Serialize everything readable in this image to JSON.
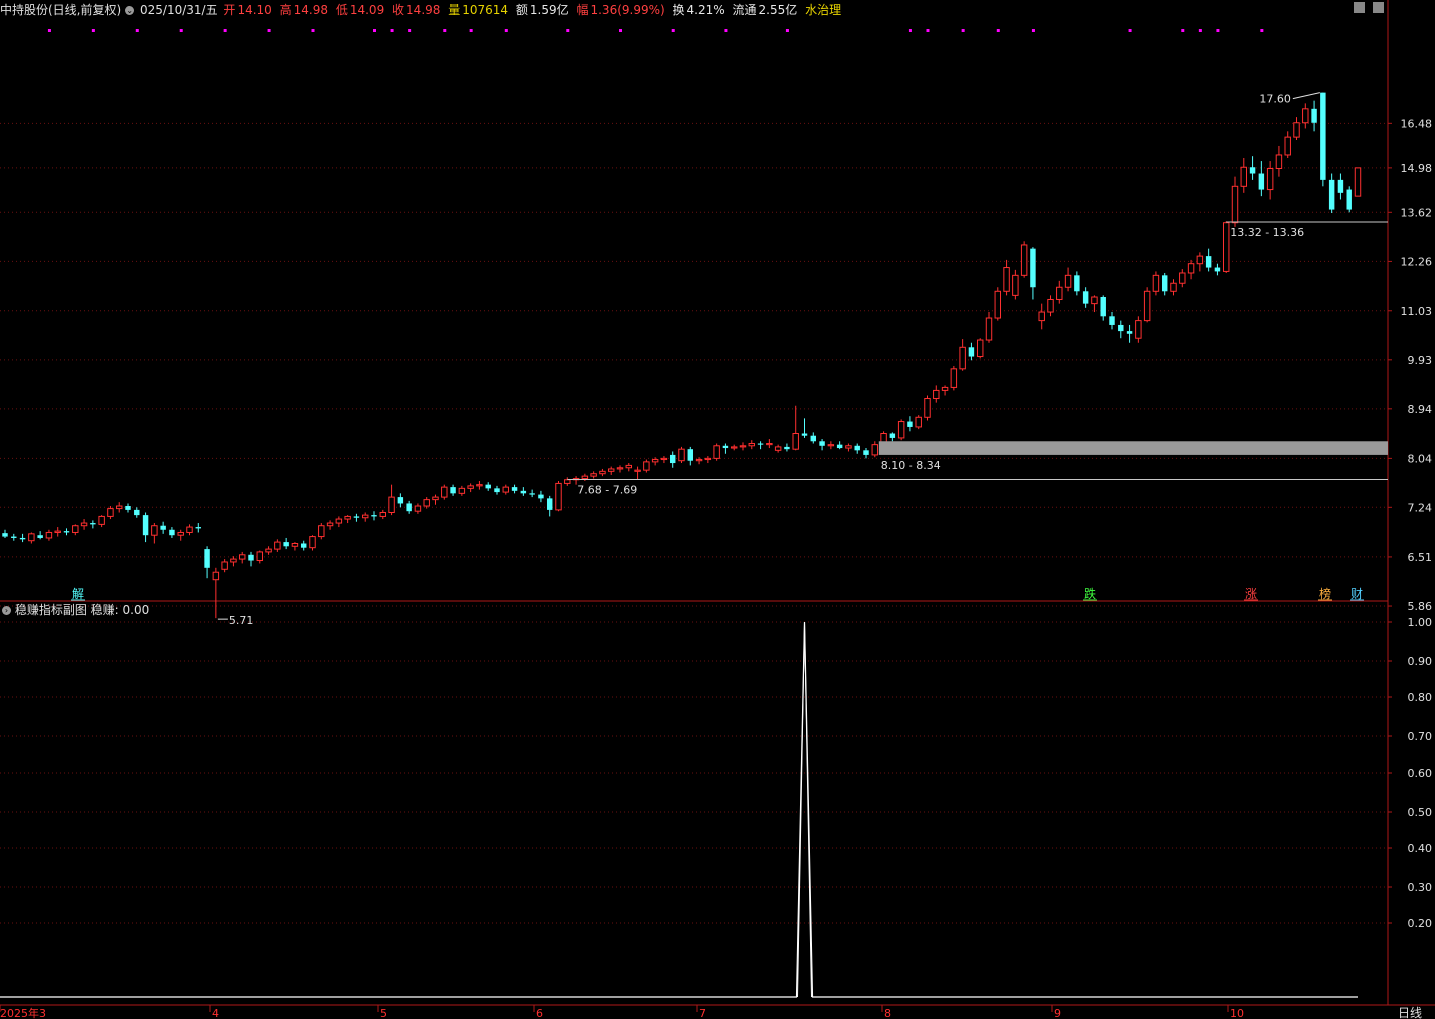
{
  "header": {
    "title": "中持股份(日线,前复权)",
    "date": "025/10/31/五",
    "open_label": "开",
    "open": "14.10",
    "high_label": "高",
    "high": "14.98",
    "low_label": "低",
    "low": "14.09",
    "close_label": "收",
    "close": "14.98",
    "volume_label": "量",
    "volume": "107614",
    "amount_label": "额",
    "amount": "1.59亿",
    "change_label": "幅",
    "change": "1.36(9.99%)",
    "turnover_label": "换",
    "turnover": "4.21%",
    "float_label": "流通",
    "float": "2.55亿",
    "sector": "水治理"
  },
  "subchart": {
    "title": "稳赚指标副图",
    "value_label": "稳赚: 0.00"
  },
  "timeframe_label": "日线",
  "colors": {
    "up": "#ff3030",
    "down": "#54ffff",
    "grid": "#6a1010",
    "axis": "#b01818",
    "text": "#e0e0e0",
    "magenta": "#ff00ff"
  },
  "chart_data": [
    {
      "type": "candlestick",
      "y_ticks": [
        "16.48",
        "14.98",
        "13.62",
        "12.26",
        "11.03",
        "9.93",
        "8.94",
        "8.04",
        "7.24",
        "6.51",
        "5.86"
      ],
      "x_ticks": [
        "2025年3",
        "4",
        "5",
        "6",
        "7",
        "8",
        "9",
        "10"
      ],
      "annotations": [
        {
          "text": "17.60",
          "role": "high"
        },
        {
          "text": "5.71",
          "role": "low"
        },
        {
          "text": "7.68 - 7.69",
          "role": "range"
        },
        {
          "text": "8.10 - 8.34",
          "role": "range"
        },
        {
          "text": "13.32 - 13.36",
          "role": "range"
        }
      ],
      "event_markers": [
        {
          "text": "解",
          "color": "#54ffff"
        },
        {
          "text": "跌",
          "color": "#40ff40"
        },
        {
          "text": "涨",
          "color": "#ff4040"
        },
        {
          "text": "榜",
          "color": "#ffb040"
        },
        {
          "text": "财",
          "color": "#54d0ff"
        }
      ],
      "candles": [
        [
          6.85,
          6.9,
          6.78,
          6.8
        ],
        [
          6.8,
          6.84,
          6.74,
          6.78
        ],
        [
          6.78,
          6.84,
          6.72,
          6.76
        ],
        [
          6.74,
          6.86,
          6.7,
          6.84
        ],
        [
          6.82,
          6.88,
          6.76,
          6.78
        ],
        [
          6.78,
          6.9,
          6.74,
          6.86
        ],
        [
          6.86,
          6.94,
          6.8,
          6.88
        ],
        [
          6.88,
          6.92,
          6.82,
          6.86
        ],
        [
          6.86,
          6.98,
          6.82,
          6.96
        ],
        [
          6.96,
          7.06,
          6.9,
          7.0
        ],
        [
          7.0,
          7.04,
          6.92,
          6.98
        ],
        [
          6.98,
          7.12,
          6.94,
          7.1
        ],
        [
          7.1,
          7.26,
          7.06,
          7.22
        ],
        [
          7.22,
          7.32,
          7.16,
          7.26
        ],
        [
          7.26,
          7.3,
          7.16,
          7.2
        ],
        [
          7.2,
          7.24,
          7.08,
          7.12
        ],
        [
          7.12,
          7.16,
          6.72,
          6.82
        ],
        [
          6.82,
          7.0,
          6.7,
          6.96
        ],
        [
          6.96,
          7.02,
          6.84,
          6.9
        ],
        [
          6.9,
          6.94,
          6.78,
          6.82
        ],
        [
          6.82,
          6.9,
          6.74,
          6.86
        ],
        [
          6.86,
          6.98,
          6.82,
          6.94
        ],
        [
          6.94,
          7.0,
          6.86,
          6.92
        ],
        [
          6.62,
          6.66,
          6.22,
          6.36
        ],
        [
          6.2,
          6.36,
          5.71,
          6.3
        ],
        [
          6.34,
          6.48,
          6.3,
          6.44
        ],
        [
          6.44,
          6.52,
          6.38,
          6.48
        ],
        [
          6.48,
          6.58,
          6.42,
          6.54
        ],
        [
          6.54,
          6.58,
          6.38,
          6.46
        ],
        [
          6.46,
          6.6,
          6.42,
          6.58
        ],
        [
          6.58,
          6.66,
          6.54,
          6.62
        ],
        [
          6.62,
          6.76,
          6.58,
          6.72
        ],
        [
          6.72,
          6.78,
          6.62,
          6.66
        ],
        [
          6.66,
          6.72,
          6.6,
          6.7
        ],
        [
          6.7,
          6.74,
          6.6,
          6.64
        ],
        [
          6.64,
          6.82,
          6.6,
          6.8
        ],
        [
          6.8,
          7.0,
          6.76,
          6.96
        ],
        [
          6.96,
          7.04,
          6.9,
          7.0
        ],
        [
          7.0,
          7.1,
          6.94,
          7.06
        ],
        [
          7.06,
          7.12,
          7.0,
          7.1
        ],
        [
          7.1,
          7.14,
          7.02,
          7.08
        ],
        [
          7.08,
          7.16,
          7.02,
          7.12
        ],
        [
          7.12,
          7.18,
          7.04,
          7.1
        ],
        [
          7.1,
          7.2,
          7.06,
          7.16
        ],
        [
          7.16,
          7.6,
          7.12,
          7.4
        ],
        [
          7.4,
          7.46,
          7.24,
          7.3
        ],
        [
          7.3,
          7.34,
          7.14,
          7.18
        ],
        [
          7.18,
          7.3,
          7.14,
          7.26
        ],
        [
          7.26,
          7.4,
          7.22,
          7.36
        ],
        [
          7.36,
          7.44,
          7.28,
          7.4
        ],
        [
          7.4,
          7.6,
          7.36,
          7.56
        ],
        [
          7.56,
          7.6,
          7.42,
          7.46
        ],
        [
          7.46,
          7.58,
          7.42,
          7.54
        ],
        [
          7.54,
          7.62,
          7.48,
          7.58
        ],
        [
          7.58,
          7.66,
          7.52,
          7.6
        ],
        [
          7.6,
          7.64,
          7.5,
          7.54
        ],
        [
          7.54,
          7.58,
          7.44,
          7.48
        ],
        [
          7.48,
          7.6,
          7.44,
          7.56
        ],
        [
          7.56,
          7.6,
          7.46,
          7.5
        ],
        [
          7.5,
          7.56,
          7.42,
          7.46
        ],
        [
          7.46,
          7.52,
          7.4,
          7.44
        ],
        [
          7.44,
          7.5,
          7.32,
          7.38
        ],
        [
          7.38,
          7.42,
          7.1,
          7.2
        ],
        [
          7.2,
          7.66,
          7.18,
          7.62
        ],
        [
          7.62,
          7.72,
          7.58,
          7.68
        ],
        [
          7.68,
          7.74,
          7.6,
          7.7
        ],
        [
          7.7,
          7.78,
          7.66,
          7.74
        ],
        [
          7.74,
          7.82,
          7.7,
          7.78
        ],
        [
          7.78,
          7.86,
          7.74,
          7.82
        ],
        [
          7.82,
          7.9,
          7.76,
          7.86
        ],
        [
          7.86,
          7.92,
          7.8,
          7.88
        ],
        [
          7.88,
          7.96,
          7.82,
          7.92
        ],
        [
          7.82,
          7.9,
          7.68,
          7.84
        ],
        [
          7.84,
          8.02,
          7.8,
          7.98
        ],
        [
          7.98,
          8.06,
          7.92,
          8.02
        ],
        [
          8.02,
          8.08,
          7.96,
          8.04
        ],
        [
          8.1,
          8.16,
          7.88,
          7.96
        ],
        [
          8.0,
          8.24,
          7.96,
          8.2
        ],
        [
          8.2,
          8.24,
          7.92,
          8.0
        ],
        [
          8.0,
          8.06,
          7.94,
          8.02
        ],
        [
          8.02,
          8.08,
          7.96,
          8.04
        ],
        [
          8.04,
          8.3,
          8.0,
          8.26
        ],
        [
          8.26,
          8.3,
          8.12,
          8.22
        ],
        [
          8.22,
          8.28,
          8.18,
          8.24
        ],
        [
          8.24,
          8.32,
          8.18,
          8.26
        ],
        [
          8.26,
          8.36,
          8.2,
          8.3
        ],
        [
          8.3,
          8.34,
          8.2,
          8.28
        ],
        [
          8.28,
          8.38,
          8.22,
          8.3
        ],
        [
          8.18,
          8.28,
          8.14,
          8.24
        ],
        [
          8.24,
          8.3,
          8.16,
          8.2
        ],
        [
          8.2,
          9.0,
          8.18,
          8.48
        ],
        [
          8.48,
          8.76,
          8.4,
          8.44
        ],
        [
          8.44,
          8.5,
          8.3,
          8.34
        ],
        [
          8.34,
          8.38,
          8.18,
          8.26
        ],
        [
          8.26,
          8.34,
          8.2,
          8.28
        ],
        [
          8.28,
          8.34,
          8.2,
          8.22
        ],
        [
          8.22,
          8.3,
          8.16,
          8.26
        ],
        [
          8.26,
          8.3,
          8.12,
          8.18
        ],
        [
          8.18,
          8.22,
          8.04,
          8.1
        ],
        [
          8.1,
          8.34,
          8.06,
          8.28
        ],
        [
          8.28,
          8.52,
          8.26,
          8.48
        ],
        [
          8.48,
          8.5,
          8.34,
          8.4
        ],
        [
          8.4,
          8.74,
          8.36,
          8.7
        ],
        [
          8.7,
          8.8,
          8.52,
          8.6
        ],
        [
          8.6,
          8.82,
          8.56,
          8.78
        ],
        [
          8.78,
          9.2,
          8.72,
          9.14
        ],
        [
          9.14,
          9.4,
          9.06,
          9.3
        ],
        [
          9.3,
          9.4,
          9.2,
          9.36
        ],
        [
          9.36,
          9.8,
          9.3,
          9.74
        ],
        [
          9.74,
          10.38,
          9.7,
          10.2
        ],
        [
          10.2,
          10.3,
          9.92,
          10.0
        ],
        [
          10.0,
          10.4,
          9.96,
          10.36
        ],
        [
          10.36,
          11.0,
          10.3,
          10.86
        ],
        [
          10.86,
          11.6,
          10.8,
          11.5
        ],
        [
          11.5,
          12.3,
          11.4,
          12.1
        ],
        [
          11.4,
          12.04,
          11.3,
          11.9
        ],
        [
          11.9,
          12.8,
          11.84,
          12.7
        ],
        [
          12.6,
          12.64,
          11.3,
          11.6
        ],
        [
          10.8,
          11.2,
          10.6,
          11.0
        ],
        [
          11.0,
          11.4,
          10.9,
          11.3
        ],
        [
          11.3,
          11.76,
          11.2,
          11.6
        ],
        [
          11.6,
          12.1,
          11.5,
          11.9
        ],
        [
          11.9,
          12.0,
          11.4,
          11.5
        ],
        [
          11.5,
          11.6,
          11.1,
          11.2
        ],
        [
          11.2,
          11.4,
          11.0,
          11.36
        ],
        [
          11.36,
          11.4,
          10.8,
          10.9
        ],
        [
          10.9,
          11.0,
          10.6,
          10.7
        ],
        [
          10.7,
          10.8,
          10.4,
          10.56
        ],
        [
          10.56,
          10.7,
          10.3,
          10.5
        ],
        [
          10.4,
          10.9,
          10.3,
          10.8
        ],
        [
          10.8,
          11.6,
          10.76,
          11.5
        ],
        [
          11.5,
          12.0,
          11.4,
          11.9
        ],
        [
          11.9,
          11.96,
          11.4,
          11.5
        ],
        [
          11.5,
          11.8,
          11.4,
          11.7
        ],
        [
          11.7,
          12.06,
          11.6,
          11.96
        ],
        [
          11.96,
          12.3,
          11.8,
          12.2
        ],
        [
          12.2,
          12.5,
          12.0,
          12.4
        ],
        [
          12.4,
          12.6,
          12.0,
          12.1
        ],
        [
          12.1,
          12.2,
          11.9,
          12.0
        ],
        [
          12.0,
          13.36,
          11.96,
          13.32
        ],
        [
          13.32,
          14.7,
          13.2,
          14.4
        ],
        [
          14.4,
          15.3,
          14.2,
          15.0
        ],
        [
          15.0,
          15.36,
          14.6,
          14.8
        ],
        [
          14.8,
          15.2,
          14.1,
          14.3
        ],
        [
          14.3,
          15.2,
          14.0,
          14.96
        ],
        [
          14.96,
          15.7,
          14.7,
          15.4
        ],
        [
          15.4,
          16.2,
          15.3,
          16.0
        ],
        [
          16.0,
          16.7,
          15.9,
          16.5
        ],
        [
          16.5,
          17.2,
          16.3,
          17.0
        ],
        [
          17.0,
          17.3,
          16.2,
          16.5
        ],
        [
          17.6,
          17.6,
          14.4,
          14.6
        ],
        [
          14.6,
          14.8,
          13.6,
          13.7
        ],
        [
          14.6,
          14.8,
          14.0,
          14.2
        ],
        [
          14.3,
          14.4,
          13.62,
          13.7
        ],
        [
          14.1,
          14.98,
          14.09,
          14.98
        ]
      ]
    },
    {
      "type": "line",
      "name": "稳赚",
      "y_ticks": [
        "1.00",
        "0.90",
        "0.80",
        "0.70",
        "0.60",
        "0.50",
        "0.40",
        "0.30",
        "0.20"
      ],
      "ylim": [
        0,
        1
      ],
      "spike_at_index": 91,
      "spike_value": 1.0,
      "baseline": 0.0
    }
  ]
}
